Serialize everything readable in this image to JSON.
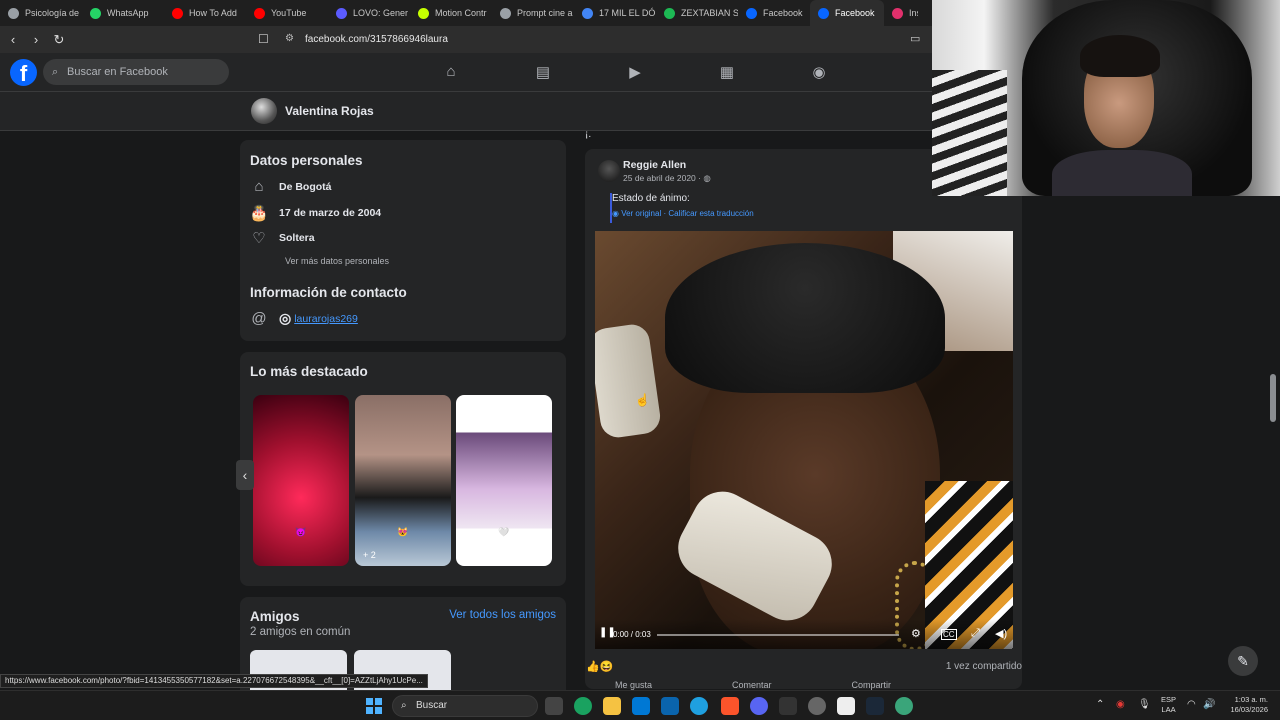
{
  "browser": {
    "tabs": [
      {
        "label": "Psicología de",
        "color": "#9aa0a6"
      },
      {
        "label": "WhatsApp",
        "color": "#25d366"
      },
      {
        "label": "How To Add",
        "color": "#ff0000"
      },
      {
        "label": "YouTube",
        "color": "#ff0000"
      },
      {
        "label": "LOVO: Gener",
        "color": "#5b5bff"
      },
      {
        "label": "Motion Contr",
        "color": "#c6ff00"
      },
      {
        "label": "Prompt cine a",
        "color": "#9aa0a6"
      },
      {
        "label": "17 MIL EL DÓ",
        "color": "#4285f4"
      },
      {
        "label": "ZEXTABIAN S",
        "color": "#1db954"
      },
      {
        "label": "Facebook",
        "color": "#0866ff"
      },
      {
        "label": "Facebook",
        "color": "#0866ff"
      },
      {
        "label": "Inst",
        "color": "#e1306c"
      }
    ],
    "url": "facebook.com/3157866946laura"
  },
  "fb": {
    "search_placeholder": "Buscar en Facebook",
    "profile_name": "Valentina Rojas"
  },
  "about": {
    "title": "Datos personales",
    "hometown": "De Bogotá",
    "birthday": "17 de marzo de 2004",
    "relationship": "Soltera",
    "more": "Ver más datos personales",
    "contact_title": "Información de contacto",
    "instagram": "laurarojas269"
  },
  "highlights": {
    "title": "Lo más destacado",
    "items": [
      {
        "emoji": "😈"
      },
      {
        "emoji": "😻",
        "badge": "+ 2"
      },
      {
        "emoji": "🤍"
      }
    ]
  },
  "friends": {
    "title": "Amigos",
    "see_all": "Ver todos los amigos",
    "mutual": "2 amigos en común"
  },
  "post": {
    "top_text": "¡.",
    "author": "Reggie Allen",
    "date": "25 de abril de 2020 · ",
    "status": "Estado de ánimo:",
    "translate": "Ver original · Calificar esta traducción",
    "video_time": "0:00 / 0:03",
    "progress": 0.0,
    "shares": "1 vez compartido",
    "actions": [
      "Me gusta",
      "Comentar",
      "Compartir"
    ]
  },
  "status_url": "https://www.facebook.com/photo/?fbid=1413455350577182&set=a.227076672548395&__cft__[0]=AZZtLjAhy1UcPe...",
  "taskbar": {
    "search": "Buscar",
    "lang_top": "ESP",
    "lang_bottom": "LAA",
    "time": "1:03 a. m.",
    "date": "16/03/2026"
  }
}
